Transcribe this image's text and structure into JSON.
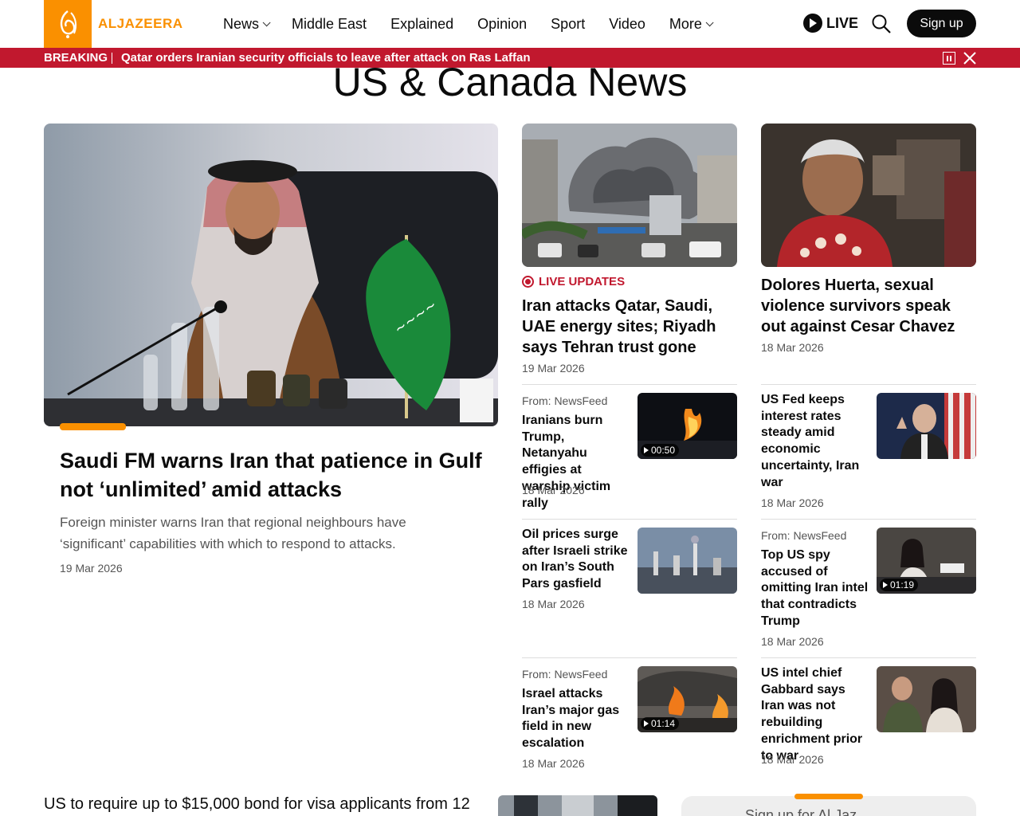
{
  "header": {
    "brand": "ALJAZEERA",
    "nav": [
      {
        "label": "News",
        "dropdown": true
      },
      {
        "label": "Middle East",
        "dropdown": false
      },
      {
        "label": "Explained",
        "dropdown": false
      },
      {
        "label": "Opinion",
        "dropdown": false
      },
      {
        "label": "Sport",
        "dropdown": false
      },
      {
        "label": "Video",
        "dropdown": false
      },
      {
        "label": "More",
        "dropdown": true
      }
    ],
    "live_label": "LIVE",
    "signup_label": "Sign up"
  },
  "breaking": {
    "label": "BREAKING",
    "text": "Qatar orders Iranian security officials to leave after attack on Ras Laffan"
  },
  "page_title": "US & Canada News",
  "hero": {
    "title": "Saudi FM warns Iran that patience in Gulf not ‘unlimited’ amid attacks",
    "description": "Foreign minister warns Iran that regional neighbours have ‘significant’ capabilities with which to respond to attacks.",
    "date": "19 Mar 2026"
  },
  "card_live": {
    "tag": "LIVE UPDATES",
    "title": "Iran attacks Qatar, Saudi, UAE energy sites; Riyadh says Tehran trust gone",
    "date": "19 Mar 2026"
  },
  "card_huerta": {
    "title": "Dolores Huerta, sexual violence survivors speak out against Cesar Chavez",
    "date": "18 Mar 2026"
  },
  "list_left": [
    {
      "from": "From: NewsFeed",
      "title": "Iranians burn Trump, Netanyahu effigies at warship victim rally",
      "date": "18 Mar 2026",
      "duration": "00:50"
    },
    {
      "from": "",
      "title": "Oil prices surge after Israeli strike on Iran’s South Pars gasfield",
      "date": "18 Mar 2026",
      "duration": ""
    },
    {
      "from": "From: NewsFeed",
      "title": "Israel attacks Iran’s major gas field in new escalation",
      "date": "18 Mar 2026",
      "duration": "01:14"
    }
  ],
  "list_right": [
    {
      "from": "",
      "title": "US Fed keeps interest rates steady amid economic uncertainty, Iran war",
      "date": "18 Mar 2026",
      "duration": ""
    },
    {
      "from": "From: NewsFeed",
      "title": "Top US spy accused of omitting Iran intel that contradicts Trump",
      "date": "18 Mar 2026",
      "duration": "01:19"
    },
    {
      "from": "",
      "title": "US intel chief Gabbard says Iran was not rebuilding enrichment prior to war",
      "date": "18 Mar 2026",
      "duration": ""
    }
  ],
  "bottom": {
    "title": "US to require up to $15,000 bond for visa applicants from 12",
    "panel_text": "Sign up for Al Jaz"
  }
}
